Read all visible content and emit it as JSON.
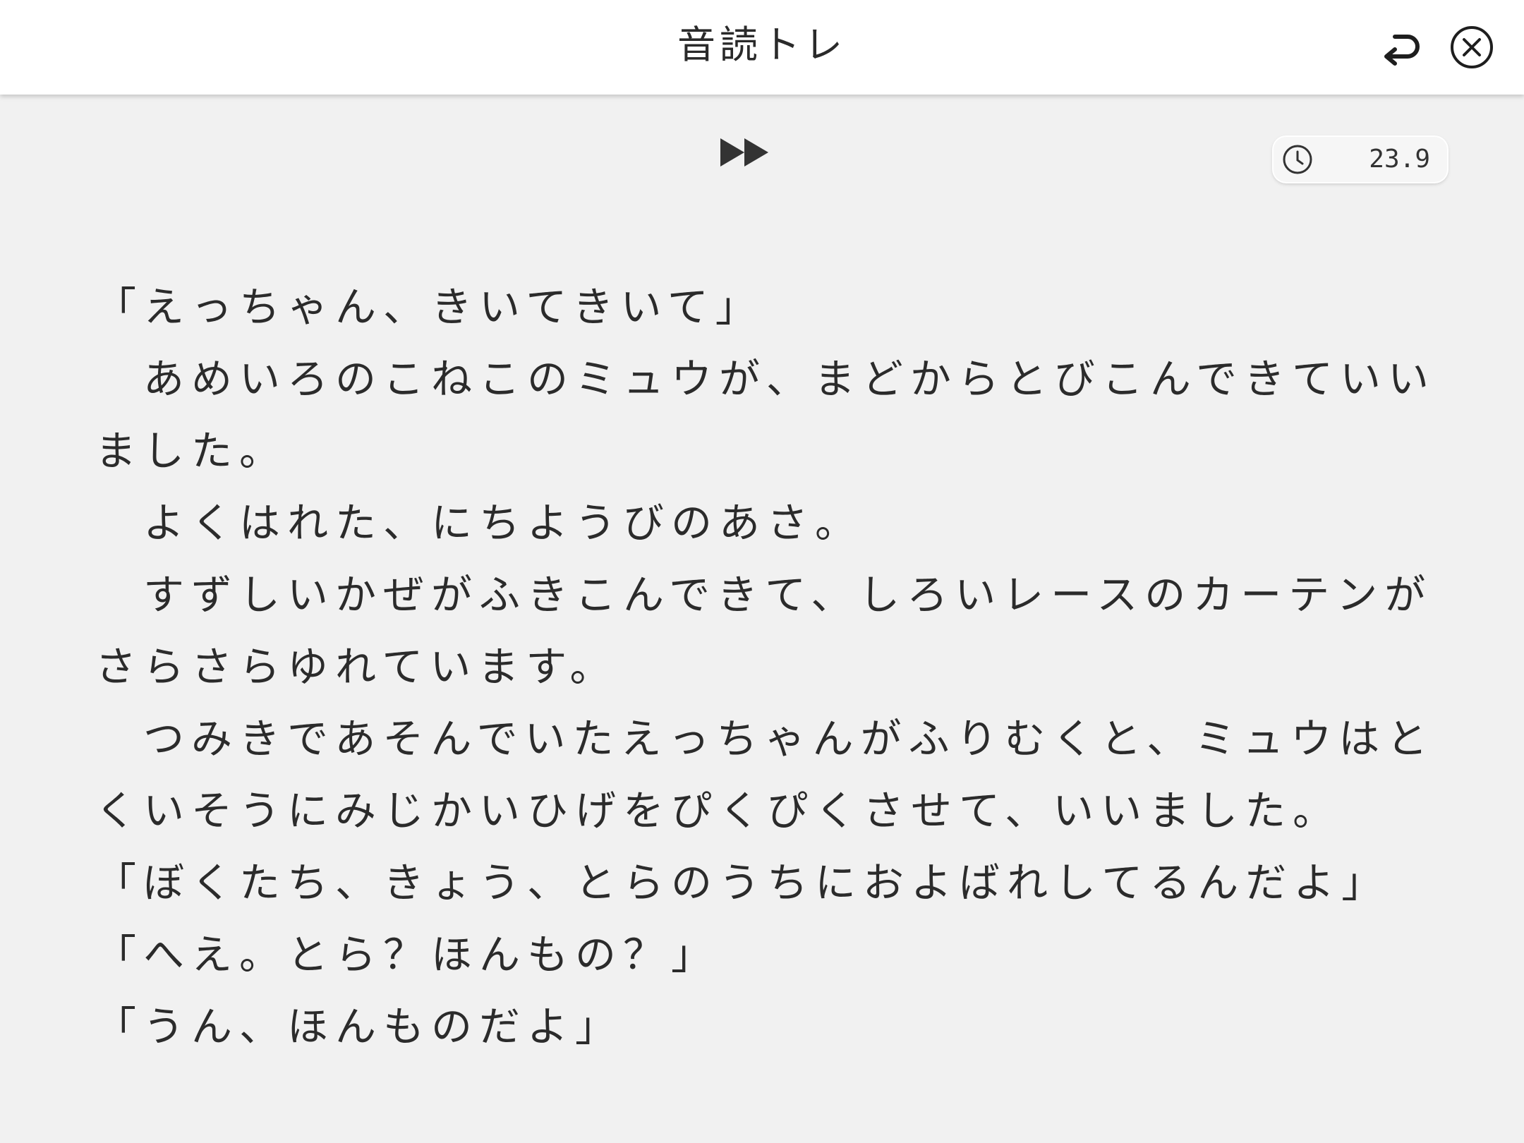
{
  "header": {
    "title": "音読トレ",
    "back_icon": "return-arrow-icon",
    "close_icon": "close-circle-icon"
  },
  "controls": {
    "fast_forward_icon": "fast-forward-icon",
    "timer": {
      "icon": "clock-icon",
      "value": "23.9"
    }
  },
  "story": {
    "paragraphs": [
      "「えっちゃん、きいてきいて」",
      "　あめいろのこねこのミュウが、まどからとびこんできていいました。",
      "　よくはれた、にちようびのあさ。",
      "　すずしいかぜがふきこんできて、しろいレースのカーテンがさらさらゆれています。",
      "　つみきであそんでいたえっちゃんがふりむくと、ミュウはとくいそうにみじかいひげをぴくぴくさせて、いいました。",
      "「ぼくたち、きょう、とらのうちにおよばれしてるんだよ」",
      "「へえ。とら？ほんもの？」",
      "「うん、ほんものだよ」"
    ]
  },
  "colors": {
    "header_bg": "#ffffff",
    "page_bg": "#f1f1f1",
    "text": "#2b2b2b"
  }
}
